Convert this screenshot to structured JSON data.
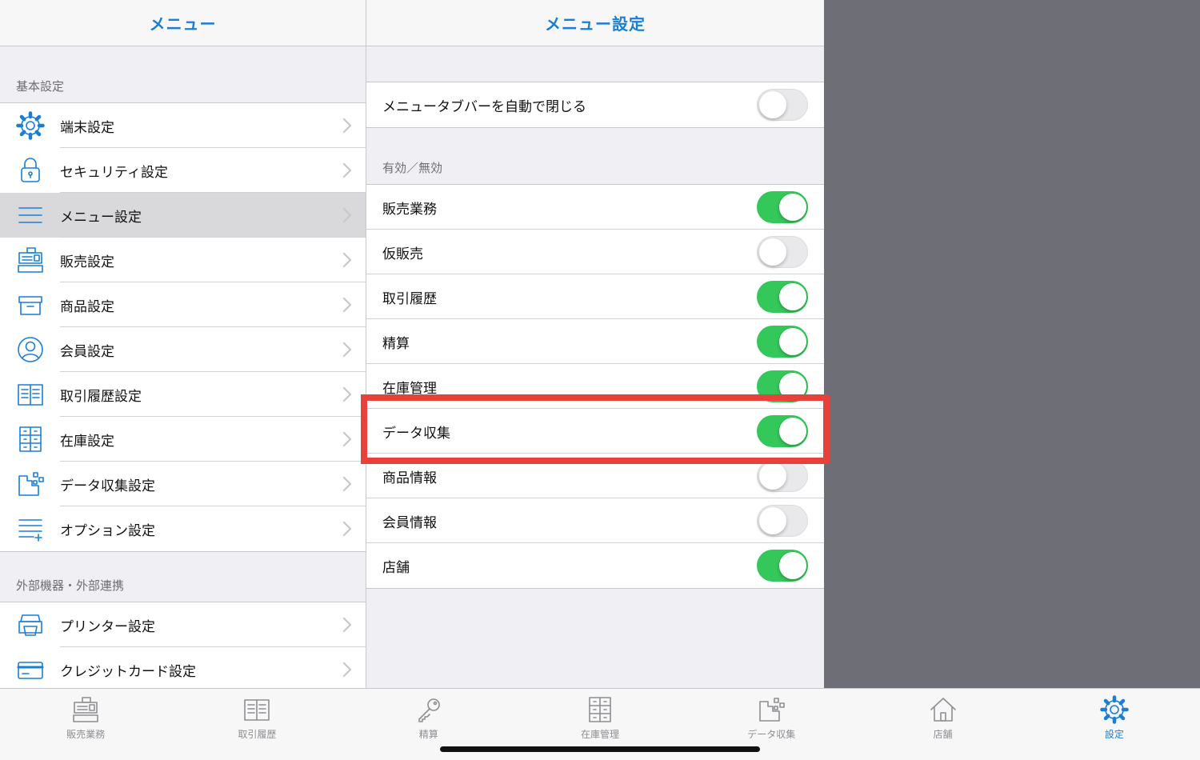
{
  "left": {
    "title": "メニュー",
    "sections": [
      {
        "header": "基本設定",
        "items": [
          {
            "label": "端末設定",
            "icon": "gear-icon"
          },
          {
            "label": "セキュリティ設定",
            "icon": "lock-icon"
          },
          {
            "label": "メニュー設定",
            "icon": "menu-lines-icon",
            "selected": true
          },
          {
            "label": "販売設定",
            "icon": "register-icon"
          },
          {
            "label": "商品設定",
            "icon": "box-icon"
          },
          {
            "label": "会員設定",
            "icon": "person-icon"
          },
          {
            "label": "取引履歴設定",
            "icon": "book-icon"
          },
          {
            "label": "在庫設定",
            "icon": "cabinet-icon"
          },
          {
            "label": "データ収集設定",
            "icon": "data-collect-icon"
          },
          {
            "label": "オプション設定",
            "icon": "list-plus-icon"
          }
        ]
      },
      {
        "header": "外部機器・外部連携",
        "items": [
          {
            "label": "プリンター設定",
            "icon": "printer-icon"
          },
          {
            "label": "クレジットカード設定",
            "icon": "credit-card-icon"
          }
        ]
      }
    ]
  },
  "middle": {
    "title": "メニュー設定",
    "top_toggle": {
      "label": "メニュータブバーを自動で閉じる",
      "on": false
    },
    "section_header": "有効／無効",
    "toggles": [
      {
        "label": "販売業務",
        "on": true
      },
      {
        "label": "仮販売",
        "on": false
      },
      {
        "label": "取引履歴",
        "on": true
      },
      {
        "label": "精算",
        "on": true
      },
      {
        "label": "在庫管理",
        "on": true
      },
      {
        "label": "データ収集",
        "on": true
      },
      {
        "label": "商品情報",
        "on": false
      },
      {
        "label": "会員情報",
        "on": false
      },
      {
        "label": "店舗",
        "on": true
      }
    ]
  },
  "tabbar": {
    "tabs": [
      {
        "label": "販売業務",
        "icon": "register-icon"
      },
      {
        "label": "取引履歴",
        "icon": "book-icon"
      },
      {
        "label": "精算",
        "icon": "key-icon"
      },
      {
        "label": "在庫管理",
        "icon": "cabinet-icon"
      },
      {
        "label": "データ収集",
        "icon": "data-collect-icon"
      },
      {
        "label": "店舗",
        "icon": "house-icon"
      },
      {
        "label": "設定",
        "icon": "gear-icon",
        "active": true
      }
    ]
  },
  "colors": {
    "accent": "#1a7fd4",
    "toggle_on": "#34c759",
    "highlight": "#e8413a",
    "backdrop": "#6d6e76"
  }
}
